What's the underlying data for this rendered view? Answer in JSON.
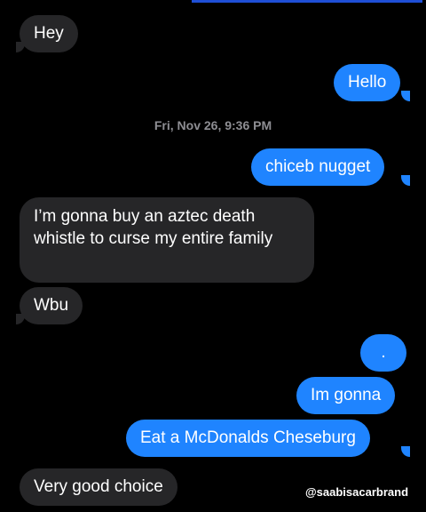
{
  "conversation": {
    "timestamp": "Fri, Nov 26, 9:36 PM",
    "messages": [
      {
        "direction": "incoming",
        "text": "Hey"
      },
      {
        "direction": "outgoing",
        "text": "Hello"
      },
      {
        "direction": "outgoing",
        "text": "chiceb nugget"
      },
      {
        "direction": "incoming",
        "text": "I’m gonna buy an aztec death whistle to curse my entire family"
      },
      {
        "direction": "incoming",
        "text": "Wbu"
      },
      {
        "direction": "outgoing",
        "text": "."
      },
      {
        "direction": "outgoing",
        "text": "Im gonna"
      },
      {
        "direction": "outgoing",
        "text": "Eat a McDonalds Cheseburg"
      },
      {
        "direction": "incoming",
        "text": "Very good choice"
      }
    ]
  },
  "watermark": "@saabisacarbrand",
  "colors": {
    "background": "#000000",
    "incoming_bubble": "#262628",
    "outgoing_bubble": "#1f84ff",
    "timestamp_text": "#8e8e93"
  }
}
